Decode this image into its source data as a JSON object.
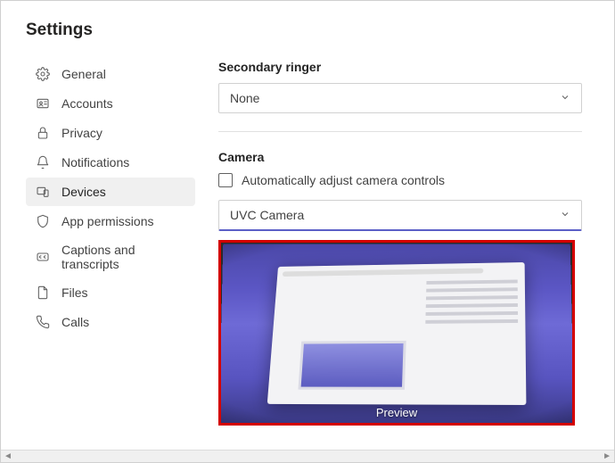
{
  "pageTitle": "Settings",
  "sidebar": {
    "items": [
      {
        "label": "General"
      },
      {
        "label": "Accounts"
      },
      {
        "label": "Privacy"
      },
      {
        "label": "Notifications"
      },
      {
        "label": "Devices"
      },
      {
        "label": "App permissions"
      },
      {
        "label": "Captions and transcripts"
      },
      {
        "label": "Files"
      },
      {
        "label": "Calls"
      }
    ],
    "activeIndex": 4
  },
  "secondaryRinger": {
    "label": "Secondary ringer",
    "value": "None"
  },
  "camera": {
    "label": "Camera",
    "autoAdjustLabel": "Automatically adjust camera controls",
    "autoAdjustChecked": false,
    "selected": "UVC Camera",
    "previewLabel": "Preview"
  }
}
